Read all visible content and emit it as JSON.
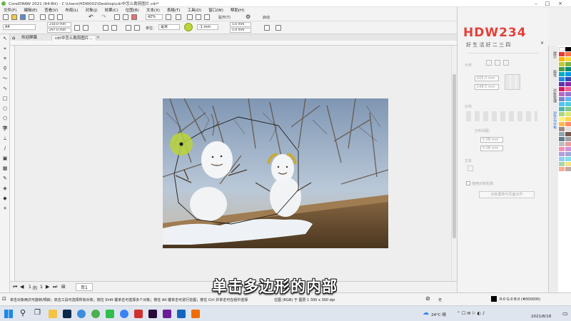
{
  "app": {
    "title": "CorelDRAW 2021 (64-Bit) - C:\\Users\\HDW002\\Desktop\\cdr中怎么裁剪图片.cdr*"
  },
  "menu": [
    "文件(F)",
    "编辑(E)",
    "查看(V)",
    "布局(L)",
    "对象(J)",
    "效果(C)",
    "位图(B)",
    "文本(X)",
    "表格(T)",
    "工具(O)",
    "窗口(W)",
    "帮助(H)"
  ],
  "toolbar": {
    "zoom": "42%",
    "snap_label": "贴齐(T)",
    "launch_label": "启动",
    "page_size": "A4",
    "width": "210.0 mm",
    "height": "297.0 mm",
    "units_label": "单位:",
    "units": "毫米",
    "nudge": ".1 mm",
    "dup_x": "5.0 mm",
    "dup_y": "5.0 mm"
  },
  "tabs": [
    {
      "label": "欢迎屏幕"
    },
    {
      "label": "cdr中怎么裁剪图片..."
    }
  ],
  "pagebar": {
    "page_current": "1",
    "page_of": "的",
    "page_total": "1",
    "page_tab": "页1"
  },
  "docker": {
    "brand": "HDW234",
    "brand_sub": "好 生 活 好 二 三 四",
    "section_align": "分布",
    "field_1": "105.0 mm",
    "field_2": "148.5 mm",
    "section_distribute": "分布",
    "dist_label": "分布间距:",
    "dist_h": "5.08 mm",
    "dist_v": "5.08 mm",
    "section_text": "文本",
    "checkbox_label": "使用对象轮廓",
    "button_label": "对象重新与页面对齐"
  },
  "docker_tabs": [
    "提示",
    "属性",
    "对象管理",
    "对齐与分布"
  ],
  "palette_colors": [
    "#ffffff",
    "#000000",
    "#e53935",
    "#ff7043",
    "#ffb300",
    "#fdd835",
    "#c0ca33",
    "#7cb342",
    "#43a047",
    "#00897b",
    "#00acc1",
    "#039be5",
    "#1e88e5",
    "#3949ab",
    "#5e35b1",
    "#8e24aa",
    "#d81b60",
    "#f06292",
    "#ba68c8",
    "#9575cd",
    "#7986cb",
    "#64b5f6",
    "#4fc3f7",
    "#4dd0e1",
    "#4db6ac",
    "#81c784",
    "#aed581",
    "#dce775",
    "#fff176",
    "#ffd54f",
    "#ffb74d",
    "#ff8a65",
    "#a1887f",
    "#e0e0e0",
    "#90a4ae",
    "#795548",
    "#607d8b",
    "#9e9e9e",
    "#bdbdbd",
    "#ef9a9a",
    "#f48fb1",
    "#ce93d8",
    "#b39ddb",
    "#9fa8da",
    "#90caf9",
    "#80deea",
    "#a5d6a7",
    "#ffe082",
    "#ffab91",
    "#bcaaa4"
  ],
  "status": {
    "hint": "单击对象两次可旋转/倾斜；双击工具可选择所有对象；按住 Shift 键单击可选择多个对象；按住 Alt 键单击可进行挖掘；按住 Ctrl 并单击可在组中选择",
    "position_info": "位图 (RGB) 于 图层 1 300 x 300 dpi",
    "fill_label": "无",
    "color_readout": "R:0 G:0 B:0 (#000000)"
  },
  "taskbar": {
    "time": "2021/8/18",
    "clock": "",
    "temp": "24°C 晴"
  },
  "caption": "单击多边形的内部"
}
